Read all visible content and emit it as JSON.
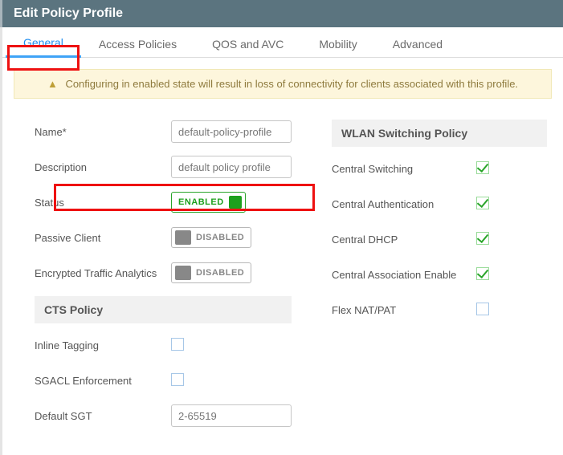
{
  "title": "Edit Policy Profile",
  "tabs": {
    "general": "General",
    "access_policies": "Access Policies",
    "qos": "QOS and AVC",
    "mobility": "Mobility",
    "advanced": "Advanced"
  },
  "warning": "Configuring in enabled state will result in loss of connectivity for clients associated with this profile.",
  "left": {
    "name_label": "Name*",
    "name_value": "default-policy-profile",
    "description_label": "Description",
    "description_value": "default policy profile",
    "status_label": "Status",
    "status_value": "ENABLED",
    "passive_label": "Passive Client",
    "passive_value": "DISABLED",
    "eta_label": "Encrypted Traffic Analytics",
    "eta_value": "DISABLED",
    "cts_header": "CTS Policy",
    "inline_tagging_label": "Inline Tagging",
    "sgacl_label": "SGACL Enforcement",
    "default_sgt_label": "Default SGT",
    "default_sgt_placeholder": "2-65519"
  },
  "right": {
    "wlan_header": "WLAN Switching Policy",
    "central_switching": "Central Switching",
    "central_auth": "Central Authentication",
    "central_dhcp": "Central DHCP",
    "central_assoc": "Central Association Enable",
    "flex_nat": "Flex NAT/PAT"
  }
}
